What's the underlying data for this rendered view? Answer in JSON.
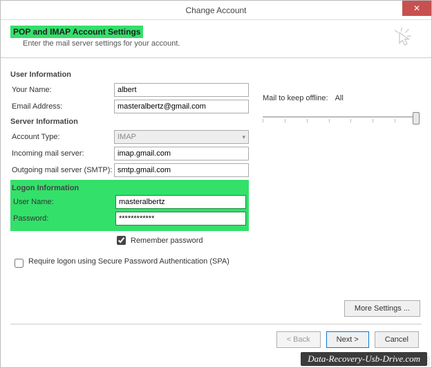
{
  "window": {
    "title": "Change Account"
  },
  "header": {
    "title": "POP and IMAP Account Settings",
    "subtitle": "Enter the mail server settings for your account."
  },
  "sections": {
    "user_info": "User Information",
    "server_info": "Server Information",
    "logon_info": "Logon Information"
  },
  "labels": {
    "your_name": "Your Name:",
    "email": "Email Address:",
    "account_type": "Account Type:",
    "incoming": "Incoming mail server:",
    "outgoing": "Outgoing mail server (SMTP):",
    "username": "User Name:",
    "password": "Password:",
    "remember": "Remember password",
    "spa": "Require logon using Secure Password Authentication (SPA)",
    "mail_offline": "Mail to keep offline:",
    "mail_offline_value": "All"
  },
  "values": {
    "your_name": "albert",
    "email": "masteralbertz@gmail.com",
    "account_type": "IMAP",
    "incoming": "imap.gmail.com",
    "outgoing": "smtp.gmail.com",
    "username": "masteralbertz",
    "password": "************",
    "remember_checked": true,
    "spa_checked": false
  },
  "buttons": {
    "more": "More Settings ...",
    "back": "< Back",
    "next": "Next >",
    "cancel": "Cancel"
  },
  "watermark": "Data-Recovery-Usb-Drive.com"
}
